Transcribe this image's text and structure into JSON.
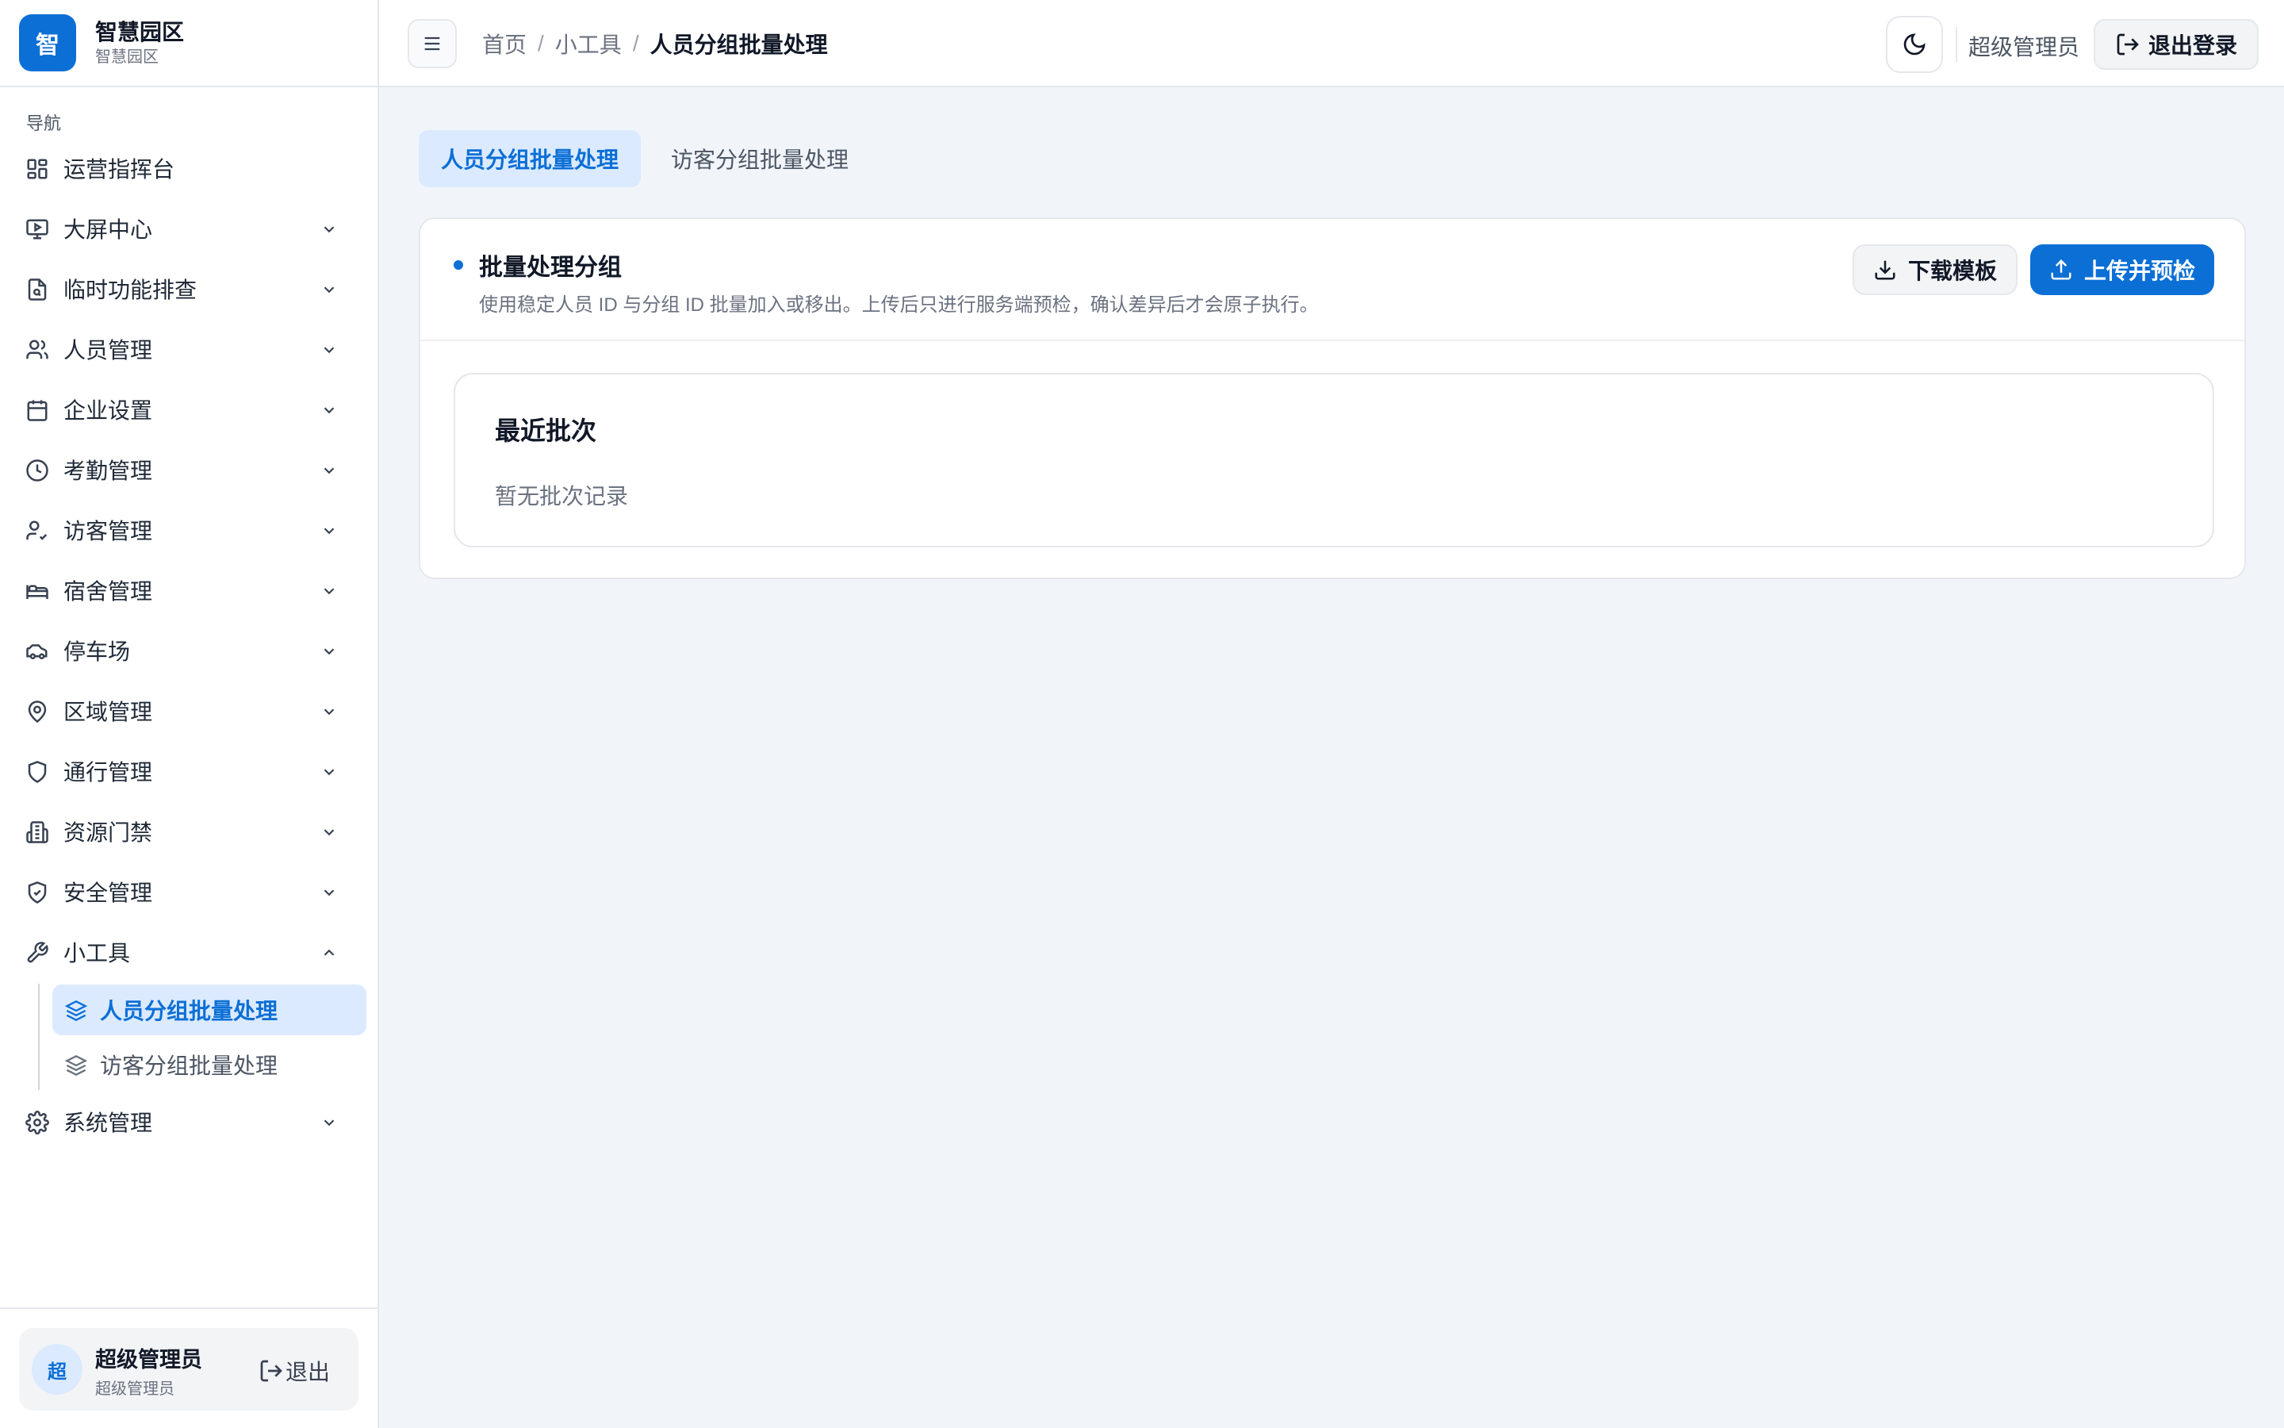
{
  "brand": {
    "logo_char": "智",
    "title": "智慧园区",
    "subtitle": "智慧园区",
    "color": "#0b6fd6"
  },
  "sidebar": {
    "caption": "导航",
    "items": [
      {
        "label": "运营指挥台",
        "icon": "dashboard-grid-icon",
        "expandable": false
      },
      {
        "label": "大屏中心",
        "icon": "monitor-icon",
        "expandable": true
      },
      {
        "label": "临时功能排查",
        "icon": "file-search-icon",
        "expandable": true
      },
      {
        "label": "人员管理",
        "icon": "users-icon",
        "expandable": true
      },
      {
        "label": "企业设置",
        "icon": "calendar-icon",
        "expandable": true
      },
      {
        "label": "考勤管理",
        "icon": "clock-icon",
        "expandable": true
      },
      {
        "label": "访客管理",
        "icon": "user-check-icon",
        "expandable": true
      },
      {
        "label": "宿舍管理",
        "icon": "bed-icon",
        "expandable": true
      },
      {
        "label": "停车场",
        "icon": "car-icon",
        "expandable": true
      },
      {
        "label": "区域管理",
        "icon": "map-pin-icon",
        "expandable": true
      },
      {
        "label": "通行管理",
        "icon": "shield-icon",
        "expandable": true
      },
      {
        "label": "资源门禁",
        "icon": "building-icon",
        "expandable": true
      },
      {
        "label": "安全管理",
        "icon": "shield-check-icon",
        "expandable": true
      },
      {
        "label": "小工具",
        "icon": "wrench-icon",
        "expandable": true,
        "expanded": true
      },
      {
        "label": "系统管理",
        "icon": "gear-icon",
        "expandable": true
      }
    ],
    "tools_children": [
      {
        "label": "人员分组批量处理",
        "icon": "layers-icon",
        "active": true
      },
      {
        "label": "访客分组批量处理",
        "icon": "layers-icon",
        "active": false
      }
    ],
    "footer": {
      "avatar_char": "超",
      "name": "超级管理员",
      "role": "超级管理员",
      "logout_label": "退出"
    }
  },
  "header": {
    "breadcrumb": [
      "首页",
      "小工具",
      "人员分组批量处理"
    ],
    "user_label": "超级管理员",
    "logout_label": "退出登录"
  },
  "main": {
    "tabs": [
      {
        "label": "人员分组批量处理",
        "active": true
      },
      {
        "label": "访客分组批量处理",
        "active": false
      }
    ],
    "panel": {
      "title": "批量处理分组",
      "description": "使用稳定人员 ID 与分组 ID 批量加入或移出。上传后只进行服务端预检，确认差异后才会原子执行。",
      "download_label": "下载模板",
      "upload_label": "上传并预检"
    },
    "recent": {
      "title": "最近批次",
      "empty_text": "暂无批次记录"
    }
  }
}
